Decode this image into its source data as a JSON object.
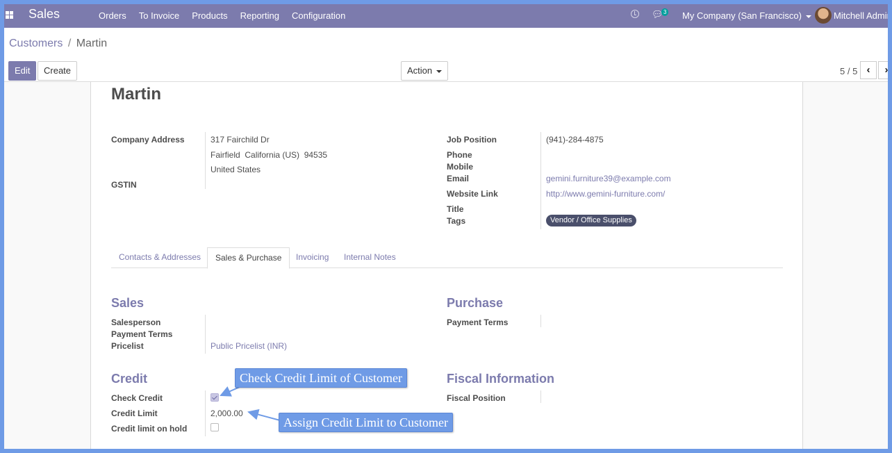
{
  "navbar": {
    "app_name": "Sales",
    "menu": [
      "Orders",
      "To Invoice",
      "Products",
      "Reporting",
      "Configuration"
    ],
    "chat_count": "3",
    "company": "My Company (San Francisco)",
    "user": "Mitchell Admin",
    "icons": [
      "apps-icon",
      "clock-icon",
      "chat-icon",
      "avatar"
    ]
  },
  "breadcrumb": {
    "parent": "Customers",
    "separator": "/",
    "current": "Martin"
  },
  "toolbar": {
    "edit": "Edit",
    "create": "Create",
    "action": "Action"
  },
  "pager": {
    "value": "5 / 5",
    "prev": "‹",
    "next": "›"
  },
  "record": {
    "name": "Martin",
    "left_fields": {
      "company_address_label": "Company Address",
      "street": "317 Fairchild Dr",
      "city_line": "Fairfield  California (US)  94535",
      "country": "United States",
      "gstin_label": "GSTIN"
    },
    "right_fields": {
      "job_position_label": "Job Position",
      "job_position": "(941)-284-4875",
      "phone_label": "Phone",
      "mobile_label": "Mobile",
      "email_label": "Email",
      "email": "gemini.furniture39@example.com",
      "website_label": "Website Link",
      "website": "http://www.gemini-furniture.com/",
      "title_label": "Title",
      "tags_label": "Tags",
      "tag": "Vendor / Office Supplies"
    }
  },
  "tabs": [
    {
      "label": "Contacts & Addresses",
      "active": false
    },
    {
      "label": "Sales & Purchase",
      "active": true
    },
    {
      "label": "Invoicing",
      "active": false
    },
    {
      "label": "Internal Notes",
      "active": false
    }
  ],
  "sales": {
    "title": "Sales",
    "salesperson_label": "Salesperson",
    "payment_terms_label": "Payment Terms",
    "pricelist_label": "Pricelist",
    "pricelist": "Public Pricelist (INR)"
  },
  "purchase": {
    "title": "Purchase",
    "payment_terms_label": "Payment Terms"
  },
  "credit": {
    "title": "Credit",
    "check_credit_label": "Check Credit",
    "check_credit": true,
    "credit_limit_label": "Credit Limit",
    "credit_limit": "2,000.00",
    "on_hold_label": "Credit limit on hold",
    "on_hold": false
  },
  "fiscal": {
    "title": "Fiscal Information",
    "fiscal_position_label": "Fiscal Position"
  },
  "annotations": {
    "check_credit_callout": "Check Credit Limit of Customer",
    "credit_limit_callout": "Assign Credit Limit to Customer",
    "color": "#6f9be6"
  }
}
